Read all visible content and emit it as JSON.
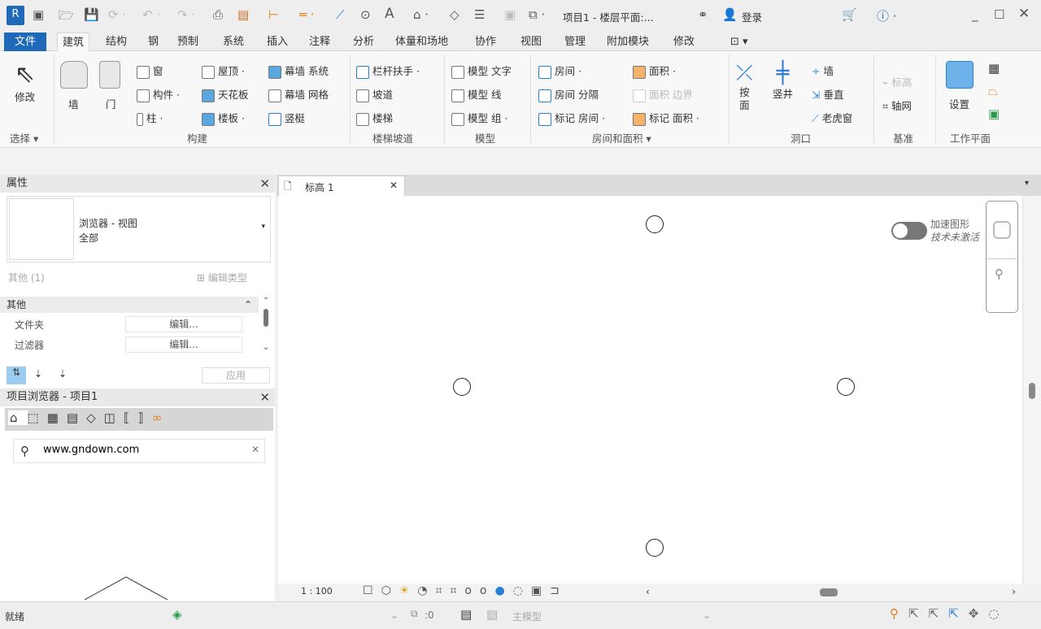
{
  "titlebar": {
    "title": "项目1 - 楼层平面:...",
    "login": "登录",
    "icons": [
      "revit-logo",
      "open-icon",
      "save-icon",
      "sync-icon",
      "undo-icon",
      "redo-icon",
      "print-icon",
      "export-icon",
      "measure-icon",
      "dimension-icon",
      "tag-icon",
      "text-icon",
      "home-icon",
      "section-icon",
      "switch-window-icon",
      "search-binoculars-icon",
      "user-icon",
      "cart-icon",
      "help-icon"
    ]
  },
  "menu_tabs": [
    "文件",
    "建筑",
    "结构",
    "钢",
    "预制",
    "系统",
    "插入",
    "注释",
    "分析",
    "体量和场地",
    "协作",
    "视图",
    "管理",
    "附加模块",
    "修改"
  ],
  "active_tab": "建筑",
  "ribbon": {
    "select": {
      "modify": "修改",
      "label": "选择 ▾"
    },
    "build": {
      "wall": "墙",
      "door": "门",
      "window": "窗",
      "component": "构件",
      "column": "柱",
      "roof": "屋顶",
      "ceiling": "天花板",
      "floor": "楼板",
      "curtain_system": "幕墙 系统",
      "curtain_grid": "幕墙 网格",
      "mullion": "竖梃",
      "label": "构建"
    },
    "circulation": {
      "railing": "栏杆扶手",
      "ramp": "坡道",
      "stair": "楼梯",
      "label": "楼梯坡道"
    },
    "model": {
      "text": "模型 文字",
      "line": "模型 线",
      "group": "模型 组",
      "label": "模型"
    },
    "room": {
      "room": "房间",
      "separator": "房间 分隔",
      "tag_room": "标记 房间",
      "area": "面积",
      "area_boundary": "面积 边界",
      "tag_area": "标记 面积",
      "label": "房间和面积 ▾"
    },
    "opening": {
      "by_face": "按\n面",
      "shaft": "竖井",
      "wall": "墙",
      "vertical": "垂直",
      "dormer": "老虎窗",
      "label": "洞口"
    },
    "datum": {
      "level": "标高",
      "grid": "轴网",
      "label": "基准"
    },
    "workplane": {
      "set": "设置",
      "label": "工作平面"
    }
  },
  "properties": {
    "title": "属性",
    "type_line1": "浏览器 - 视图",
    "type_line2": "全部",
    "filter": "其他 (1)",
    "edit_type": "编辑类型",
    "group": "其他",
    "rows": [
      {
        "name": "文件夹",
        "value": "编辑..."
      },
      {
        "name": "过滤器",
        "value": "编辑..."
      }
    ],
    "apply": "应用"
  },
  "browser": {
    "title": "项目浏览器 - 项目1",
    "search_value": "www.gndown.com"
  },
  "view": {
    "tab": "标高 1",
    "toggle_line1": "加速图形",
    "toggle_line2": "技术未激活",
    "toggle_on": false,
    "scale": "1 : 100"
  },
  "status": {
    "text": "就绪",
    "count": ":0",
    "model": "主模型"
  }
}
